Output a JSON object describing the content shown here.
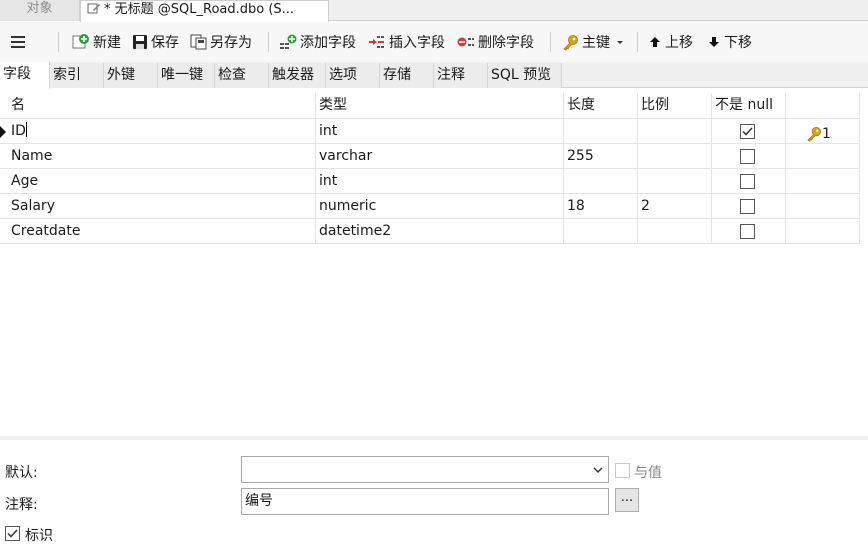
{
  "tabs": {
    "objects_label": "对象",
    "document_label": "* 无标题 @SQL_Road.dbo (S..."
  },
  "toolbar": {
    "menu_icon": "hamburger-icon",
    "new_label": "新建",
    "save_label": "保存",
    "save_as_label": "另存为",
    "add_field_label": "添加字段",
    "insert_field_label": "插入字段",
    "delete_field_label": "删除字段",
    "primary_key_label": "主键",
    "move_up_label": "上移",
    "move_down_label": "下移"
  },
  "subtabs": [
    "字段",
    "索引",
    "外键",
    "唯一键",
    "检查",
    "触发器",
    "选项",
    "存储",
    "注释",
    "SQL 预览"
  ],
  "columns": {
    "name": "名",
    "type": "类型",
    "length": "长度",
    "scale": "比例",
    "not_null": "不是 null"
  },
  "rows": [
    {
      "name": "ID",
      "type": "int",
      "length": "",
      "scale": "",
      "not_null": true,
      "key": "1"
    },
    {
      "name": "Name",
      "type": "varchar",
      "length": "255",
      "scale": "",
      "not_null": false,
      "key": ""
    },
    {
      "name": "Age",
      "type": "int",
      "length": "",
      "scale": "",
      "not_null": false,
      "key": ""
    },
    {
      "name": "Salary",
      "type": "numeric",
      "length": "18",
      "scale": "2",
      "not_null": false,
      "key": ""
    },
    {
      "name": "Creatdate",
      "type": "datetime2",
      "length": "",
      "scale": "",
      "not_null": false,
      "key": ""
    }
  ],
  "properties": {
    "default_label": "默认:",
    "default_value": "",
    "with_value_label": "与值",
    "comment_label": "注释:",
    "comment_value": "编号",
    "ellipsis_label": "...",
    "identity_label": "标识",
    "identity_checked": true
  },
  "colors": {
    "accent_green": "#2e9e3e",
    "accent_red": "#d23b3b",
    "key_gold": "#d8a417"
  }
}
